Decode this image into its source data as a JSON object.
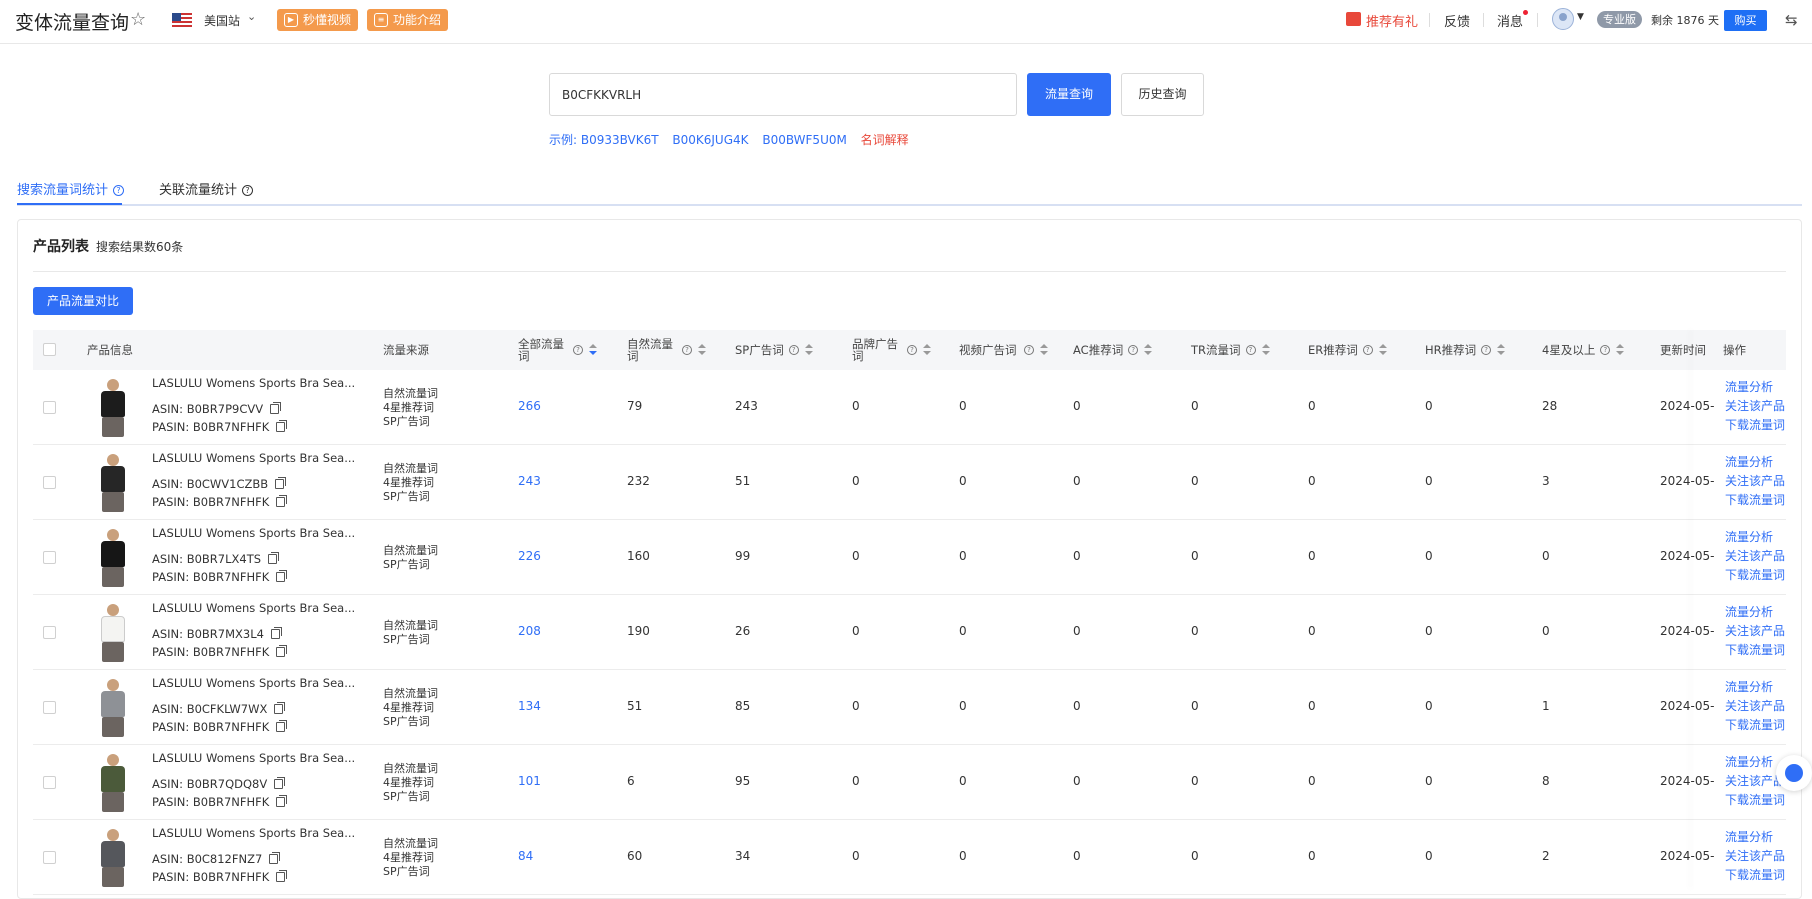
{
  "header": {
    "title": "变体流量查询",
    "site": "美国站",
    "video_btn": "秒懂视频",
    "intro_btn": "功能介绍",
    "promo": "推荐有礼",
    "feedback": "反馈",
    "messages": "消息",
    "plan_badge": "专业版",
    "remaining": "剩余 1876 天",
    "buy": "购买"
  },
  "search": {
    "value": "B0CFKKVRLH",
    "query_btn": "流量查询",
    "history_btn": "历史查询",
    "example_label": "示例:",
    "examples": [
      "B0933BVK6T",
      "B00K6JUG4K",
      "B00BWF5U0M"
    ],
    "glossary": "名词解释"
  },
  "tabs": {
    "search_stats": "搜索流量词统计",
    "related_stats": "关联流量统计"
  },
  "panel": {
    "title": "产品列表",
    "count": "搜索结果数60条",
    "compare_btn": "产品流量对比"
  },
  "columns": {
    "product": "产品信息",
    "source": "流量来源",
    "all": "全部流量词",
    "organic": "自然流量词",
    "sp": "SP广告词",
    "brand": "品牌广告词",
    "video": "视频广告词",
    "ac": "AC推荐词",
    "tr": "TR流量词",
    "er": "ER推荐词",
    "hr": "HR推荐词",
    "four_star": "4星及以上",
    "updated": "更新时间",
    "ops": "操作"
  },
  "ops_labels": [
    "流量分析",
    "关注该产品",
    "下载流量词"
  ],
  "rows": [
    {
      "name": "LASLULU Womens Sports Bra Sea...",
      "asin": "ASIN: B0BR7P9CVV",
      "pasin": "PASIN: B0BR7NFHFK",
      "sources": [
        "自然流量词",
        "4星推荐词",
        "SP广告词"
      ],
      "all": "266",
      "organic": "79",
      "sp": "243",
      "brand": "0",
      "video": "0",
      "ac": "0",
      "tr": "0",
      "er": "0",
      "hr": "0",
      "four_star": "28",
      "updated": "2024-05-",
      "shirt": "#1c1c1c"
    },
    {
      "name": "LASLULU Womens Sports Bra Sea...",
      "asin": "ASIN: B0CWV1CZBB",
      "pasin": "PASIN: B0BR7NFHFK",
      "sources": [
        "自然流量词",
        "4星推荐词",
        "SP广告词"
      ],
      "all": "243",
      "organic": "232",
      "sp": "51",
      "brand": "0",
      "video": "0",
      "ac": "0",
      "tr": "0",
      "er": "0",
      "hr": "0",
      "four_star": "3",
      "updated": "2024-05-",
      "shirt": "#262626"
    },
    {
      "name": "LASLULU Womens Sports Bra Sea...",
      "asin": "ASIN: B0BR7LX4TS",
      "pasin": "PASIN: B0BR7NFHFK",
      "sources": [
        "自然流量词",
        "SP广告词"
      ],
      "all": "226",
      "organic": "160",
      "sp": "99",
      "brand": "0",
      "video": "0",
      "ac": "0",
      "tr": "0",
      "er": "0",
      "hr": "0",
      "four_star": "0",
      "updated": "2024-05-",
      "shirt": "#161616"
    },
    {
      "name": "LASLULU Womens Sports Bra Sea...",
      "asin": "ASIN: B0BR7MX3L4",
      "pasin": "PASIN: B0BR7NFHFK",
      "sources": [
        "自然流量词",
        "SP广告词"
      ],
      "all": "208",
      "organic": "190",
      "sp": "26",
      "brand": "0",
      "video": "0",
      "ac": "0",
      "tr": "0",
      "er": "0",
      "hr": "0",
      "four_star": "0",
      "updated": "2024-05-",
      "shirt": "#f4f4f2"
    },
    {
      "name": "LASLULU Womens Sports Bra Sea...",
      "asin": "ASIN: B0CFKLW7WX",
      "pasin": "PASIN: B0BR7NFHFK",
      "sources": [
        "自然流量词",
        "4星推荐词",
        "SP广告词"
      ],
      "all": "134",
      "organic": "51",
      "sp": "85",
      "brand": "0",
      "video": "0",
      "ac": "0",
      "tr": "0",
      "er": "0",
      "hr": "0",
      "four_star": "1",
      "updated": "2024-05-",
      "shirt": "#8e9196"
    },
    {
      "name": "LASLULU Womens Sports Bra Sea...",
      "asin": "ASIN: B0BR7QDQ8V",
      "pasin": "PASIN: B0BR7NFHFK",
      "sources": [
        "自然流量词",
        "4星推荐词",
        "SP广告词"
      ],
      "all": "101",
      "organic": "6",
      "sp": "95",
      "brand": "0",
      "video": "0",
      "ac": "0",
      "tr": "0",
      "er": "0",
      "hr": "0",
      "four_star": "8",
      "updated": "2024-05-",
      "shirt": "#4b5a3a"
    },
    {
      "name": "LASLULU Womens Sports Bra Sea...",
      "asin": "ASIN: B0C812FNZ7",
      "pasin": "PASIN: B0BR7NFHFK",
      "sources": [
        "自然流量词",
        "4星推荐词",
        "SP广告词"
      ],
      "all": "84",
      "organic": "60",
      "sp": "34",
      "brand": "0",
      "video": "0",
      "ac": "0",
      "tr": "0",
      "er": "0",
      "hr": "0",
      "four_star": "2",
      "updated": "2024-05-",
      "shirt": "#55575c"
    }
  ]
}
